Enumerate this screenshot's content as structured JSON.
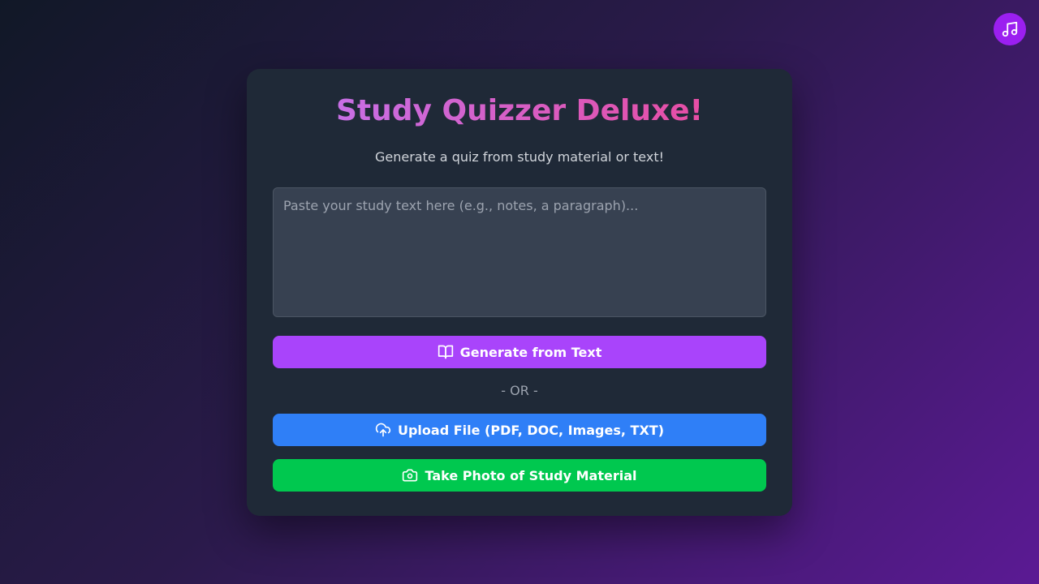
{
  "app": {
    "title": "Study Quizzer Deluxe!",
    "subtitle": "Generate a quiz from study material or text!"
  },
  "input": {
    "placeholder": "Paste your study text here (e.g., notes, a paragraph)...",
    "value": ""
  },
  "buttons": {
    "generate_text": "Generate from Text",
    "upload_file": "Upload File (PDF, DOC, Images, TXT)",
    "take_photo": "Take Photo of Study Material"
  },
  "divider": "- OR -",
  "icons": {
    "music": "music-note-icon",
    "generate": "book-open-icon",
    "upload": "cloud-upload-icon",
    "photo": "camera-icon"
  },
  "colors": {
    "music_button": "#9b1ff0",
    "generate_button": "#a944fb",
    "upload_button": "#2f7ff7",
    "photo_button": "#00c84f",
    "card": "#1f2937",
    "title_gradient_start": "#c274f0",
    "title_gradient_end": "#ec4899"
  }
}
